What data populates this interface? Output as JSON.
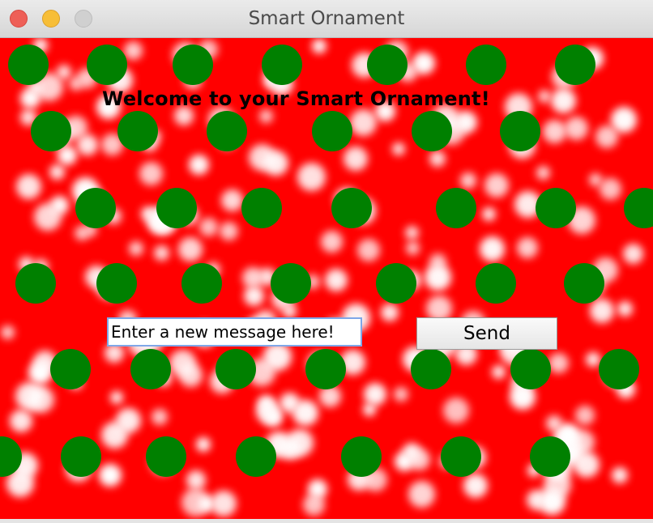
{
  "window": {
    "title": "Smart Ornament"
  },
  "main": {
    "heading": "Welcome to your Smart Ornament!",
    "message_input": {
      "value": "Enter a new message here!"
    },
    "send_label": "Send"
  },
  "colors": {
    "background": "#ff0000",
    "dots": "#008000",
    "sparkle": "#ffffff"
  }
}
